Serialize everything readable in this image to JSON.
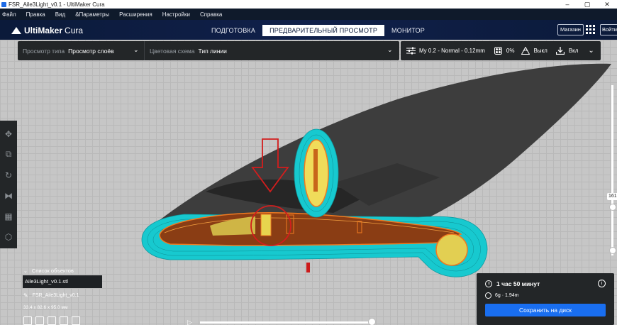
{
  "window": {
    "title": "FSR_Aile3Light_v0.1 - UltiMaker Cura",
    "minimize": "–",
    "maximize": "▢",
    "close": "✕"
  },
  "menu": [
    "Файл",
    "Правка",
    "Вид",
    "&Параметры",
    "Расширения",
    "Настройки",
    "Справка"
  ],
  "header": {
    "logo_bold": "UltiMaker",
    "logo_rest": "Cura",
    "stages": [
      "ПОДГОТОВКА",
      "ПРЕДВАРИТЕЛЬНЫЙ ПРОСМОТР",
      "МОНИТОР"
    ],
    "active_stage": 1,
    "store": "Магазин",
    "login": "Войти"
  },
  "viewbar": {
    "view_type_label": "Просмотр типа",
    "view_type_value": "Просмотр слоёв",
    "color_scheme_label": "Цветовая схема",
    "color_scheme_value": "Тип линии"
  },
  "printbar": {
    "profile": "My 0.2 - Normal - 0.12mm",
    "infill": "0%",
    "support": "Выкл",
    "adhesion": "Вкл"
  },
  "left_tools": [
    "move-tool",
    "scale-tool",
    "rotate-tool",
    "mirror-tool",
    "per-model-settings-tool",
    "support-blocker-tool"
  ],
  "layer_slider": {
    "value": "161"
  },
  "object_list": {
    "toggle_label": "Список объектов",
    "selected_item": "Aile3Light_v0.1.stl",
    "job_name": "FSR_Aile3Light_v0.1",
    "dimensions": "33.4 x 82.6 x 95.0 мм"
  },
  "print_panel": {
    "time": "1 час 50 минут",
    "material": "6g · 1.94m",
    "info_icon": "i",
    "save_button": "Сохранить на диск"
  },
  "colors": {
    "header_bg": "#0b1a3a",
    "panel_bg": "#232628",
    "accent_blue": "#196ef0",
    "shell_cyan": "#1cd0d0",
    "wall_orange": "#c8651a",
    "infill_yellow": "#f2e060",
    "annotation_red": "#d31d1d"
  }
}
